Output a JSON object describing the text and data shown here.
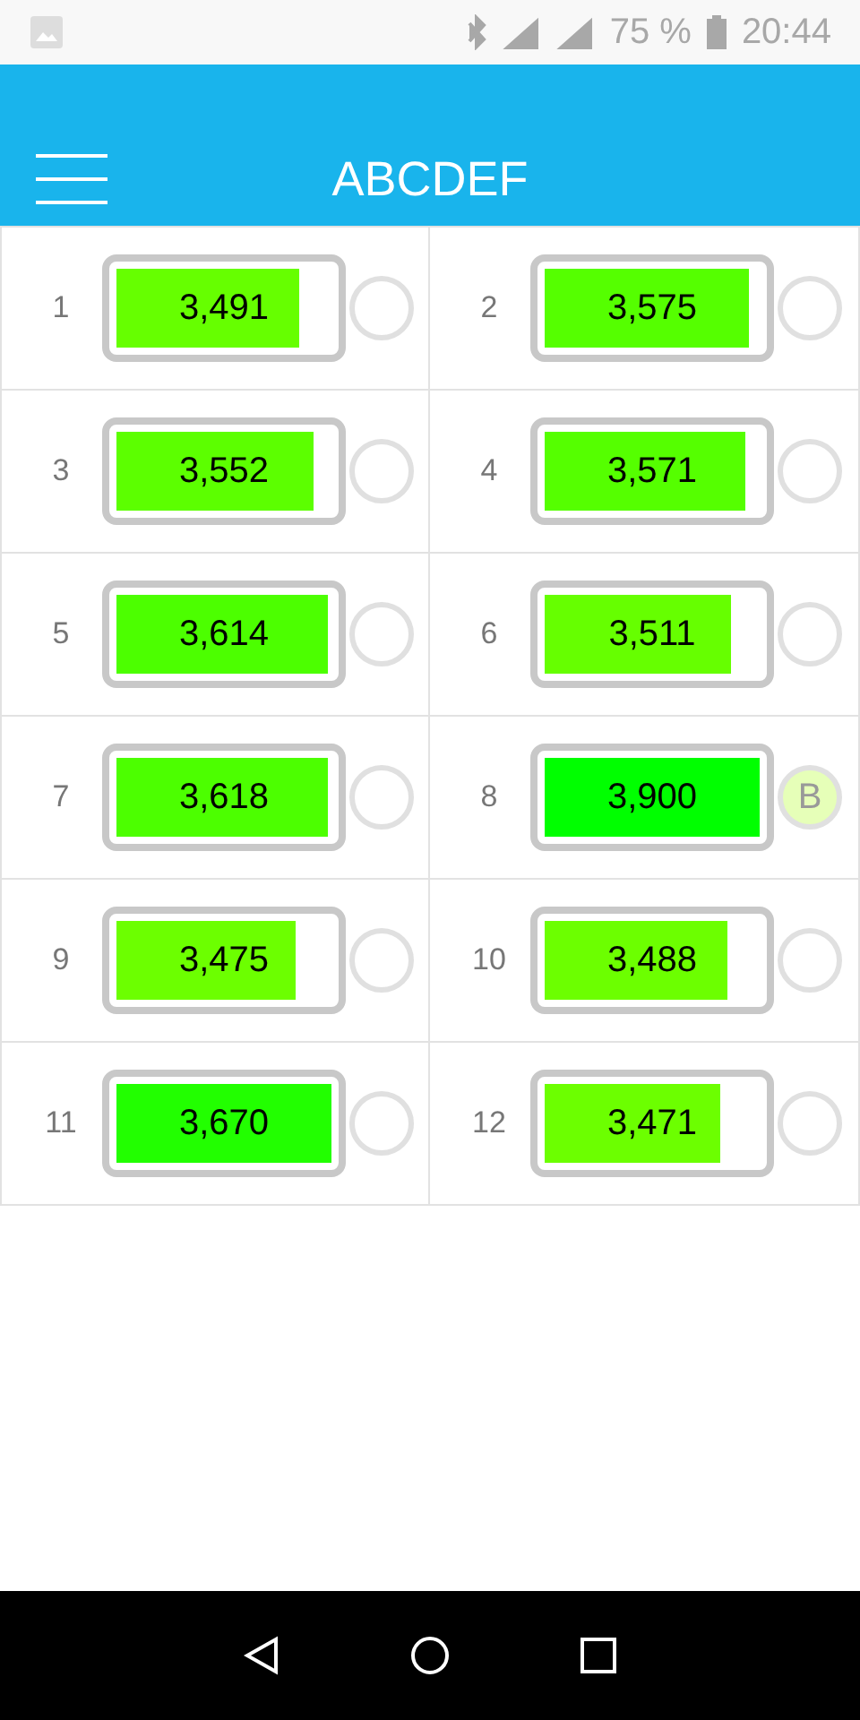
{
  "status_bar": {
    "battery": "75 %",
    "time": "20:44"
  },
  "app_bar": {
    "title": "ABCDEF"
  },
  "cells": [
    {
      "number": "1",
      "reading": "3,491",
      "level": 0.85,
      "color": "#66ff00",
      "marked": false
    },
    {
      "number": "2",
      "reading": "3,575",
      "level": 0.95,
      "color": "#55ff00",
      "marked": false
    },
    {
      "number": "3",
      "reading": "3,552",
      "level": 0.92,
      "color": "#5cff00",
      "marked": false
    },
    {
      "number": "4",
      "reading": "3,571",
      "level": 0.93,
      "color": "#55ff00",
      "marked": false
    },
    {
      "number": "5",
      "reading": "3,614",
      "level": 0.98,
      "color": "#4cff00",
      "marked": false
    },
    {
      "number": "6",
      "reading": "3,511",
      "level": 0.87,
      "color": "#66ff00",
      "marked": false
    },
    {
      "number": "7",
      "reading": "3,618",
      "level": 0.98,
      "color": "#4cff00",
      "marked": false
    },
    {
      "number": "8",
      "reading": "3,900",
      "level": 1,
      "color": "#00ff00",
      "marked": true,
      "badge": "B"
    },
    {
      "number": "9",
      "reading": "3,475",
      "level": 0.83,
      "color": "#6cff00",
      "marked": false
    },
    {
      "number": "10",
      "reading": "3,488",
      "level": 0.85,
      "color": "#6cff00",
      "marked": false
    },
    {
      "number": "11",
      "reading": "3,670",
      "level": 1,
      "color": "#22ff00",
      "marked": false
    },
    {
      "number": "12",
      "reading": "3,471",
      "level": 0.82,
      "color": "#6cff00",
      "marked": false
    }
  ]
}
